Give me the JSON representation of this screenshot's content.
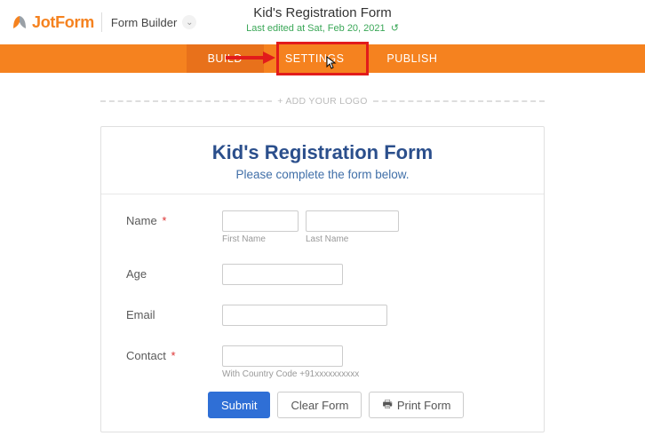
{
  "header": {
    "logo_text": "JotForm",
    "builder_label": "Form Builder",
    "form_title": "Kid's Registration Form",
    "last_edited": "Last edited at Sat, Feb 20, 2021"
  },
  "tabs": {
    "build": "BUILD",
    "settings": "SETTINGS",
    "publish": "PUBLISH"
  },
  "canvas": {
    "add_logo": "+ ADD YOUR LOGO"
  },
  "card": {
    "title": "Kid's Registration Form",
    "subtitle": "Please complete the form below."
  },
  "fields": {
    "name": {
      "label": "Name",
      "required": "*",
      "first_sub": "First Name",
      "last_sub": "Last Name"
    },
    "age": {
      "label": "Age"
    },
    "email": {
      "label": "Email"
    },
    "contact": {
      "label": "Contact",
      "required": "*",
      "hint": "With Country Code +91xxxxxxxxxx"
    }
  },
  "buttons": {
    "submit": "Submit",
    "clear": "Clear Form",
    "print": "Print Form"
  }
}
